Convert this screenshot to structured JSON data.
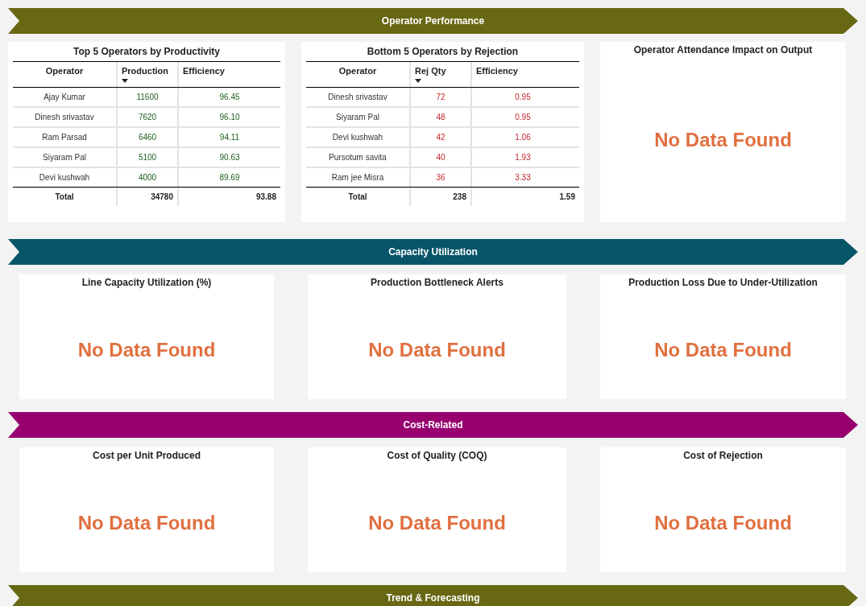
{
  "sections": [
    {
      "title": "Operator Performance",
      "color": "#686814",
      "panels": [
        {
          "kind": "productivity_table",
          "title": "Top 5 Operators by Productivity",
          "columns": [
            {
              "label": "Operator",
              "sorted": false
            },
            {
              "label": "Production",
              "sorted": true
            },
            {
              "label": "Efficiency",
              "sorted": false
            }
          ],
          "rows": [
            [
              "Ajay Kumar",
              "11600",
              "96.45"
            ],
            [
              "Dinesh srivastav",
              "7620",
              "96.10"
            ],
            [
              "Ram Parsad",
              "6460",
              "94.11"
            ],
            [
              "Siyaram Pal",
              "5100",
              "90.63"
            ],
            [
              "Devi kushwah",
              "4000",
              "89.69"
            ]
          ],
          "total": [
            "Total",
            "34780",
            "93.88"
          ]
        },
        {
          "kind": "rejection_table",
          "title": "Bottom 5 Operators by Rejection",
          "columns": [
            {
              "label": "Operator",
              "sorted": false
            },
            {
              "label": "Rej Qty",
              "sorted": true
            },
            {
              "label": "Efficiency",
              "sorted": false
            }
          ],
          "rows": [
            [
              "Dinesh srivastav",
              "72",
              "0.95"
            ],
            [
              "Siyaram Pal",
              "48",
              "0.95"
            ],
            [
              "Devi kushwah",
              "42",
              "1.06"
            ],
            [
              "Pursotum savita",
              "40",
              "1.93"
            ],
            [
              "Ram jee Misra",
              "36",
              "3.33"
            ]
          ],
          "total": [
            "Total",
            "238",
            "1.59"
          ]
        },
        {
          "kind": "empty",
          "title": "Operator Attendance Impact on Output",
          "message": "No Data Found"
        }
      ]
    },
    {
      "title": "Capacity Utilization",
      "color": "#08556a",
      "panels": [
        {
          "kind": "empty",
          "title": "Line Capacity Utilization (%)",
          "message": "No Data Found"
        },
        {
          "kind": "empty",
          "title": "Production Bottleneck Alerts",
          "message": "No Data Found"
        },
        {
          "kind": "empty",
          "title": "Production Loss Due to Under-Utilization",
          "message": "No Data Found"
        }
      ]
    },
    {
      "title": "Cost-Related",
      "color": "#980070",
      "panels": [
        {
          "kind": "empty",
          "title": "Cost per Unit Produced",
          "message": "No Data Found"
        },
        {
          "kind": "empty",
          "title": "Cost of Quality (COQ)",
          "message": "No Data Found"
        },
        {
          "kind": "empty",
          "title": "Cost of Rejection",
          "message": "No Data Found"
        }
      ]
    },
    {
      "title": "Trend & Forecasting",
      "color": "#686814"
    }
  ]
}
